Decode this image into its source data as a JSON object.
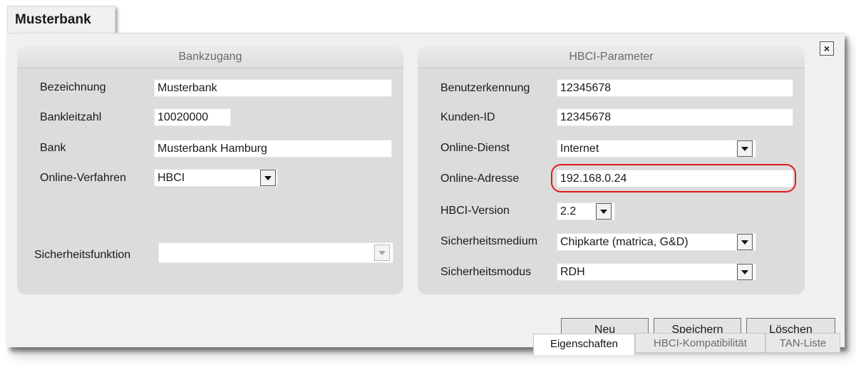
{
  "window": {
    "title": "Musterbank",
    "close_glyph": "×"
  },
  "bankzugang": {
    "header": "Bankzugang",
    "bezeichnung": {
      "label": "Bezeichnung",
      "value": "Musterbank"
    },
    "bankleitzahl": {
      "label": "Bankleitzahl",
      "value": "10020000"
    },
    "bank": {
      "label": "Bank",
      "value": "Musterbank Hamburg"
    },
    "online_verfahren": {
      "label": "Online-Verfahren",
      "value": "HBCI"
    },
    "sicherheitsfunktion": {
      "label": "Sicherheitsfunktion",
      "value": ""
    }
  },
  "hbci": {
    "header": "HBCI-Parameter",
    "benutzerkennung": {
      "label": "Benutzerkennung",
      "value": "12345678"
    },
    "kunden_id": {
      "label": "Kunden-ID",
      "value": "12345678"
    },
    "online_dienst": {
      "label": "Online-Dienst",
      "value": "Internet"
    },
    "online_adresse": {
      "label": "Online-Adresse",
      "value": "192.168.0.24"
    },
    "hbci_version": {
      "label": "HBCI-Version",
      "value": "2.2"
    },
    "sicherheitsmedium": {
      "label": "Sicherheitsmedium",
      "value": "Chipkarte (matrica, G&D)"
    },
    "sicherheitsmodus": {
      "label": "Sicherheitsmodus",
      "value": "RDH"
    }
  },
  "buttons": {
    "neu_first": "N",
    "neu_rest": "eu",
    "speichern_first": "S",
    "speichern_rest": "peichern",
    "loeschen_first": "L",
    "loeschen_rest": "öschen"
  },
  "tabs": [
    "Eigenschaften",
    "HBCI-Kompatibilität",
    "TAN-Liste"
  ],
  "colors": {
    "highlight": "#e01b1b",
    "panel": "#dcdcdc",
    "window": "#f0f0f0"
  }
}
